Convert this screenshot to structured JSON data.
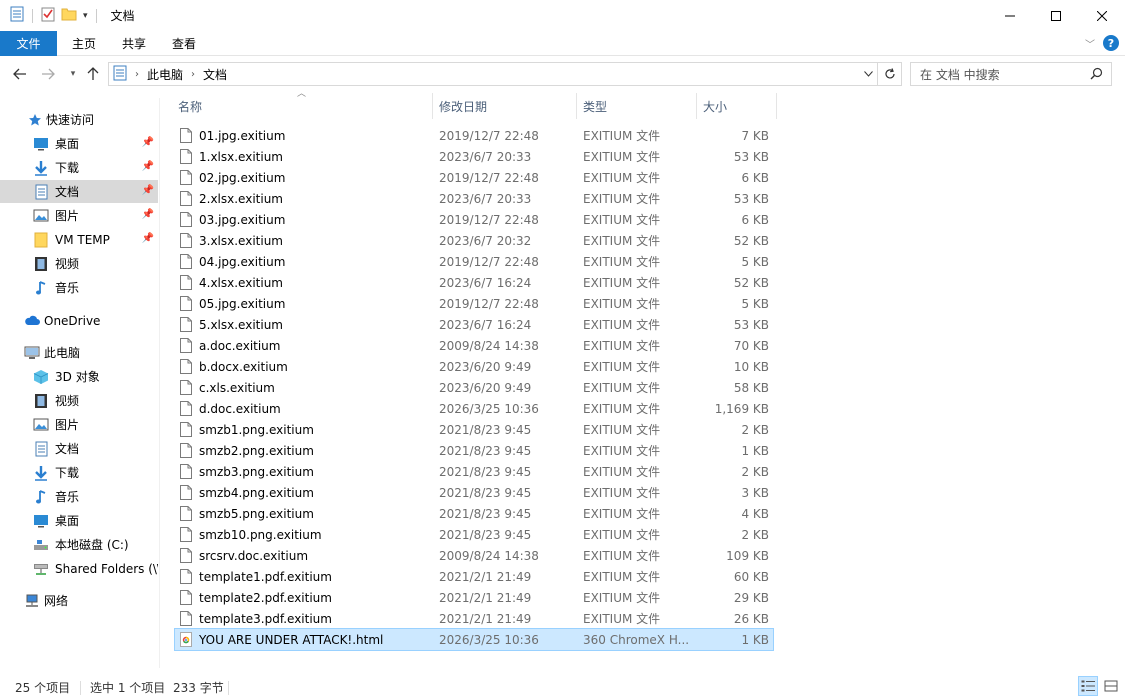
{
  "window": {
    "title": "文档",
    "controls": [
      "minimize",
      "maximize",
      "close"
    ]
  },
  "ribbon": {
    "tabs": [
      "文件",
      "主页",
      "共享",
      "查看"
    ]
  },
  "address": {
    "path": [
      "此电脑",
      "文档"
    ]
  },
  "search": {
    "placeholder": "在 文档 中搜索"
  },
  "nav": {
    "quick_access": "快速访问",
    "quick_items": [
      {
        "label": "桌面",
        "icon": "desktop-icon",
        "pinned": true
      },
      {
        "label": "下载",
        "icon": "download-icon",
        "pinned": true
      },
      {
        "label": "文档",
        "icon": "documents-icon",
        "pinned": true,
        "selected": true
      },
      {
        "label": "图片",
        "icon": "pictures-icon",
        "pinned": true
      },
      {
        "label": "VM TEMP",
        "icon": "folder-icon",
        "pinned": true
      },
      {
        "label": "视频",
        "icon": "videos-icon",
        "pinned": false
      },
      {
        "label": "音乐",
        "icon": "music-icon",
        "pinned": false
      }
    ],
    "onedrive": "OneDrive",
    "this_pc": "此电脑",
    "pc_items": [
      {
        "label": "3D 对象",
        "icon": "3d-objects-icon"
      },
      {
        "label": "视频",
        "icon": "videos-icon"
      },
      {
        "label": "图片",
        "icon": "pictures-icon"
      },
      {
        "label": "文档",
        "icon": "documents-icon"
      },
      {
        "label": "下载",
        "icon": "download-icon"
      },
      {
        "label": "音乐",
        "icon": "music-icon"
      },
      {
        "label": "桌面",
        "icon": "desktop-icon"
      },
      {
        "label": "本地磁盘 (C:)",
        "icon": "drive-icon"
      },
      {
        "label": "Shared Folders (\\\\",
        "icon": "network-drive-icon"
      }
    ],
    "network": "网络"
  },
  "columns": {
    "name": "名称",
    "date": "修改日期",
    "type": "类型",
    "size": "大小"
  },
  "files": [
    {
      "name": "01.jpg.exitium",
      "date": "2019/12/7 22:48",
      "type": "EXITIUM 文件",
      "size": "7 KB"
    },
    {
      "name": "1.xlsx.exitium",
      "date": "2023/6/7 20:33",
      "type": "EXITIUM 文件",
      "size": "53 KB"
    },
    {
      "name": "02.jpg.exitium",
      "date": "2019/12/7 22:48",
      "type": "EXITIUM 文件",
      "size": "6 KB"
    },
    {
      "name": "2.xlsx.exitium",
      "date": "2023/6/7 20:33",
      "type": "EXITIUM 文件",
      "size": "53 KB"
    },
    {
      "name": "03.jpg.exitium",
      "date": "2019/12/7 22:48",
      "type": "EXITIUM 文件",
      "size": "6 KB"
    },
    {
      "name": "3.xlsx.exitium",
      "date": "2023/6/7 20:32",
      "type": "EXITIUM 文件",
      "size": "52 KB"
    },
    {
      "name": "04.jpg.exitium",
      "date": "2019/12/7 22:48",
      "type": "EXITIUM 文件",
      "size": "5 KB"
    },
    {
      "name": "4.xlsx.exitium",
      "date": "2023/6/7 16:24",
      "type": "EXITIUM 文件",
      "size": "52 KB"
    },
    {
      "name": "05.jpg.exitium",
      "date": "2019/12/7 22:48",
      "type": "EXITIUM 文件",
      "size": "5 KB"
    },
    {
      "name": "5.xlsx.exitium",
      "date": "2023/6/7 16:24",
      "type": "EXITIUM 文件",
      "size": "53 KB"
    },
    {
      "name": "a.doc.exitium",
      "date": "2009/8/24 14:38",
      "type": "EXITIUM 文件",
      "size": "70 KB"
    },
    {
      "name": "b.docx.exitium",
      "date": "2023/6/20 9:49",
      "type": "EXITIUM 文件",
      "size": "10 KB"
    },
    {
      "name": "c.xls.exitium",
      "date": "2023/6/20 9:49",
      "type": "EXITIUM 文件",
      "size": "58 KB"
    },
    {
      "name": "d.doc.exitium",
      "date": "2026/3/25 10:36",
      "type": "EXITIUM 文件",
      "size": "1,169 KB"
    },
    {
      "name": "smzb1.png.exitium",
      "date": "2021/8/23 9:45",
      "type": "EXITIUM 文件",
      "size": "2 KB"
    },
    {
      "name": "smzb2.png.exitium",
      "date": "2021/8/23 9:45",
      "type": "EXITIUM 文件",
      "size": "1 KB"
    },
    {
      "name": "smzb3.png.exitium",
      "date": "2021/8/23 9:45",
      "type": "EXITIUM 文件",
      "size": "2 KB"
    },
    {
      "name": "smzb4.png.exitium",
      "date": "2021/8/23 9:45",
      "type": "EXITIUM 文件",
      "size": "3 KB"
    },
    {
      "name": "smzb5.png.exitium",
      "date": "2021/8/23 9:45",
      "type": "EXITIUM 文件",
      "size": "4 KB"
    },
    {
      "name": "smzb10.png.exitium",
      "date": "2021/8/23 9:45",
      "type": "EXITIUM 文件",
      "size": "2 KB"
    },
    {
      "name": "srcsrv.doc.exitium",
      "date": "2009/8/24 14:38",
      "type": "EXITIUM 文件",
      "size": "109 KB"
    },
    {
      "name": "template1.pdf.exitium",
      "date": "2021/2/1 21:49",
      "type": "EXITIUM 文件",
      "size": "60 KB"
    },
    {
      "name": "template2.pdf.exitium",
      "date": "2021/2/1 21:49",
      "type": "EXITIUM 文件",
      "size": "29 KB"
    },
    {
      "name": "template3.pdf.exitium",
      "date": "2021/2/1 21:49",
      "type": "EXITIUM 文件",
      "size": "26 KB"
    },
    {
      "name": "YOU ARE UNDER ATTACK!.html",
      "date": "2026/3/25 10:36",
      "type": "360 ChromeX H...",
      "size": "1 KB",
      "selected": true,
      "icon": "browser-html-icon"
    }
  ],
  "status": {
    "count": "25 个项目",
    "selection": "选中 1 个项目",
    "selection_size": "233 字节"
  },
  "colors": {
    "accent": "#1979ca",
    "selection_bg": "#cce8ff",
    "selection_border": "#99d1ff",
    "nav_selected": "#d9d9d9"
  }
}
